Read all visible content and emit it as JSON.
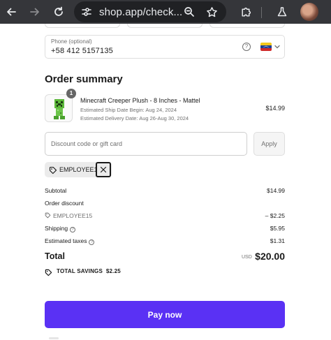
{
  "browser": {
    "url": "shop.app/check...",
    "icons": {
      "back": "arrow-left-icon",
      "forward": "arrow-right-icon",
      "reload": "reload-icon",
      "site_settings": "tune-icon",
      "zoom": "magnifier-icon",
      "bookmark": "star-icon",
      "extensions": "puzzle-icon",
      "labs": "flask-icon",
      "profile": "avatar"
    }
  },
  "phone": {
    "label": "Phone (optional)",
    "value": "+58 412 5157135",
    "help_icon": "question-circle-icon",
    "country_flag": "venezuela-flag-icon"
  },
  "order_summary": {
    "title": "Order summary",
    "item": {
      "quantity": "1",
      "name": "Minecraft Creeper Plush - 8 Inches - Mattel",
      "ship_date": "Estimated Ship Date Begin: Aug 24, 2024",
      "delivery_date": "Estimated Delivery Date: Aug 26-Aug 30, 2024",
      "price": "$14.99"
    },
    "discount": {
      "placeholder": "Discount code or gift card",
      "apply_label": "Apply",
      "applied_code": "EMPLOYEE15"
    },
    "lines": {
      "subtotal_label": "Subtotal",
      "subtotal_value": "$14.99",
      "order_discount_label": "Order discount",
      "discount_code": "EMPLOYEE15",
      "discount_value": "– $2.25",
      "shipping_label": "Shipping",
      "shipping_value": "$5.95",
      "taxes_label": "Estimated taxes",
      "taxes_value": "$1.31"
    },
    "total": {
      "label": "Total",
      "currency": "USD",
      "value": "$20.00"
    },
    "savings": "TOTAL SAVINGS  $2.25"
  },
  "pay_button": "Pay now",
  "colors": {
    "primary": "#5a31f4",
    "toolbar": "#35363a",
    "omnibox": "#202124",
    "text": "#1a1a1a",
    "muted": "#707070"
  }
}
